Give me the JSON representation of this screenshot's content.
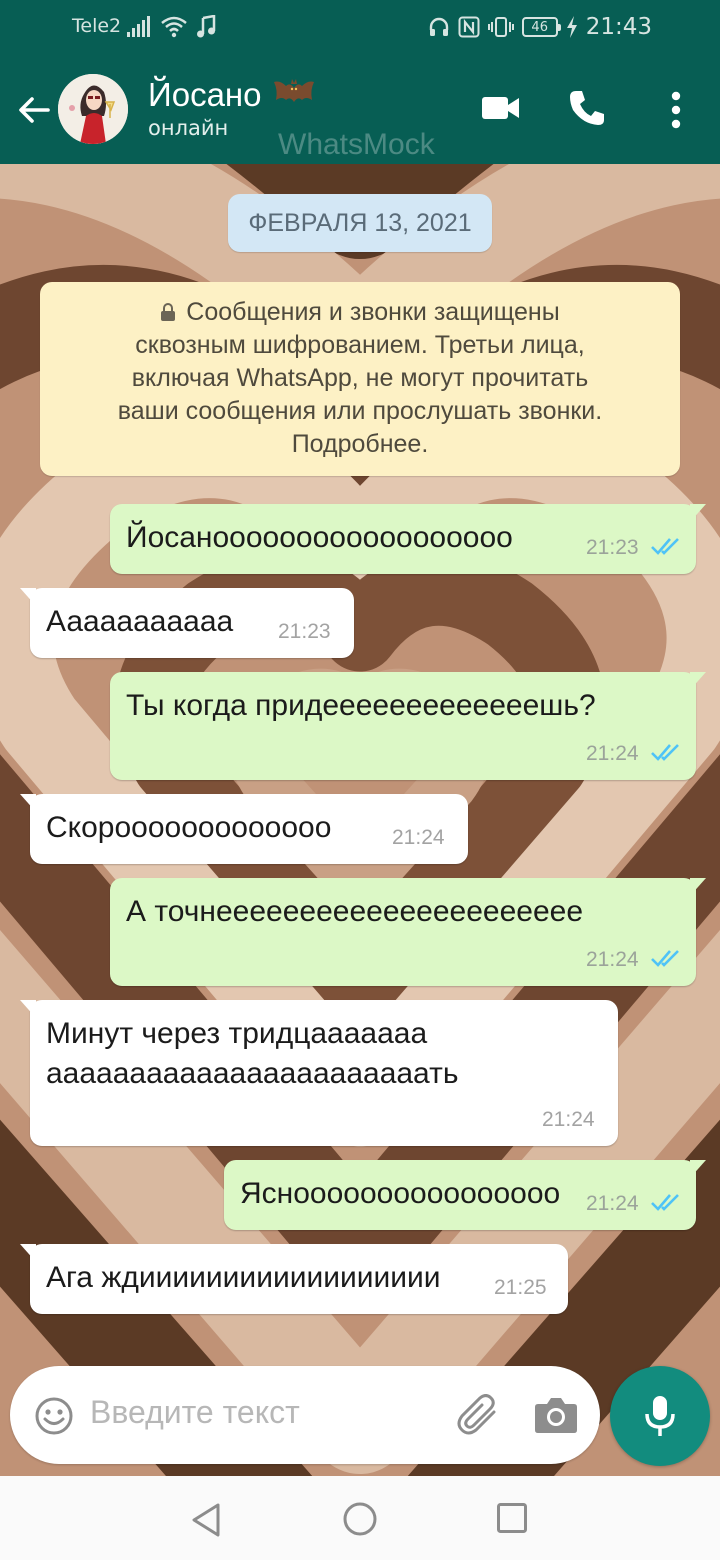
{
  "status_bar": {
    "carrier": "Tele2",
    "battery_level": "46",
    "time": "21:43"
  },
  "header": {
    "contact_name": "Йосано",
    "contact_status": "онлайн",
    "watermark": "WhatsMock",
    "icons": [
      "back-arrow-icon",
      "avatar",
      "bat-emoji",
      "video-call-icon",
      "phone-icon",
      "more-vert-icon"
    ]
  },
  "chat": {
    "date_chip": "ФЕВРАЛЯ 13, 2021",
    "encryption_notice": [
      "Сообщения и звонки защищены",
      "сквозным шифрованием. Третьи лица,",
      "включая WhatsApp, не могут прочитать",
      "ваши сообщения или прослушать звонки.",
      "Подробнее."
    ],
    "messages": [
      {
        "direction": "out",
        "text": [
          "Йосаноооооооооооооооооо"
        ],
        "time": "21:23",
        "status": "read"
      },
      {
        "direction": "in",
        "text": [
          "Ааааааааааа"
        ],
        "time": "21:23"
      },
      {
        "direction": "out",
        "text": [
          "Ты когда придееееееееееееешь?"
        ],
        "time": "21:24",
        "status": "read"
      },
      {
        "direction": "in",
        "text": [
          "Скорооооооооооооо"
        ],
        "time": "21:24"
      },
      {
        "direction": "out",
        "text": [
          "А точнееееееееееееееееееееее"
        ],
        "time": "21:24",
        "status": "read"
      },
      {
        "direction": "in",
        "text": [
          "Минут через тридцааааааа",
          "ааааааааааааааааааааааать"
        ],
        "time": "21:24"
      },
      {
        "direction": "out",
        "text": [
          "Ясноооооооооооооооо"
        ],
        "time": "21:24",
        "status": "read"
      },
      {
        "direction": "in",
        "text": [
          "Ага ждииииииииииииииииии"
        ],
        "time": "21:25"
      }
    ]
  },
  "composer": {
    "placeholder": "Введите текст",
    "icons": [
      "emoji-icon",
      "attach-icon",
      "camera-icon",
      "mic-icon"
    ]
  },
  "nav_bar": {
    "icons": [
      "nav-back-icon",
      "nav-home-icon",
      "nav-recents-icon"
    ]
  },
  "colors": {
    "header": "#075e54",
    "outgoing_bubble": "#dcf8c6",
    "incoming_bubble": "#ffffff",
    "date_chip": "#d3e7f5",
    "notice": "#fdf1c5",
    "read_ticks": "#4fc3f7",
    "mic_button": "#128c7e"
  }
}
